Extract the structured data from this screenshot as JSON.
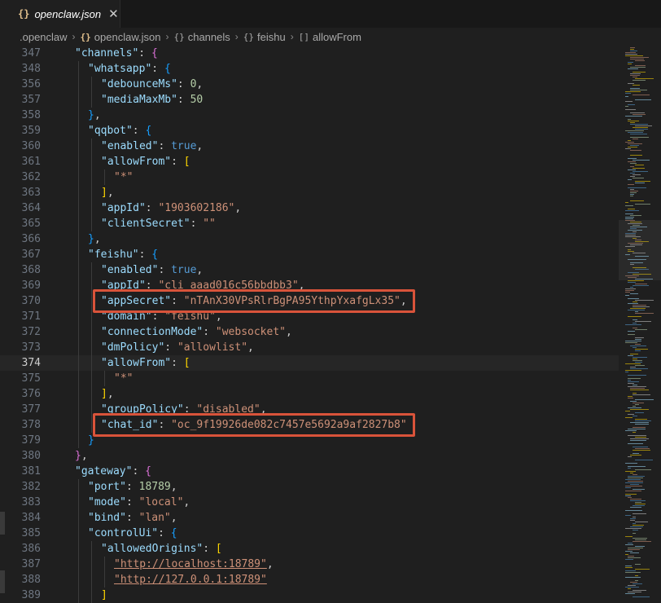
{
  "tab": {
    "icon": "{}",
    "name": "openclaw.json",
    "close": "✕"
  },
  "breadcrumb": [
    {
      "icon": "",
      "label": ".openclaw"
    },
    {
      "icon": "{}",
      "label": "openclaw.json"
    },
    {
      "icon": "{}",
      "label": "channels"
    },
    {
      "icon": "{}",
      "label": "feishu"
    },
    {
      "icon": "[]",
      "label": "allowFrom"
    }
  ],
  "editor": {
    "current_line": 374,
    "lines": [
      {
        "num": "347",
        "indent": 0,
        "tokens": [
          [
            "k",
            "\"channels\""
          ],
          [
            "p",
            ": "
          ],
          [
            "br2",
            "{"
          ]
        ]
      },
      {
        "num": "348",
        "indent": 1,
        "tokens": [
          [
            "k",
            "\"whatsapp\""
          ],
          [
            "p",
            ": "
          ],
          [
            "br3",
            "{"
          ]
        ]
      },
      {
        "num": "356",
        "indent": 2,
        "tokens": [
          [
            "k",
            "\"debounceMs\""
          ],
          [
            "p",
            ": "
          ],
          [
            "n",
            "0"
          ],
          [
            "p",
            ","
          ]
        ]
      },
      {
        "num": "357",
        "indent": 2,
        "tokens": [
          [
            "k",
            "\"mediaMaxMb\""
          ],
          [
            "p",
            ": "
          ],
          [
            "n",
            "50"
          ]
        ]
      },
      {
        "num": "358",
        "indent": 1,
        "tokens": [
          [
            "br3",
            "}"
          ],
          [
            "p",
            ","
          ]
        ]
      },
      {
        "num": "359",
        "indent": 1,
        "tokens": [
          [
            "k",
            "\"qqbot\""
          ],
          [
            "p",
            ": "
          ],
          [
            "br3",
            "{"
          ]
        ]
      },
      {
        "num": "360",
        "indent": 2,
        "tokens": [
          [
            "k",
            "\"enabled\""
          ],
          [
            "p",
            ": "
          ],
          [
            "b",
            "true"
          ],
          [
            "p",
            ","
          ]
        ]
      },
      {
        "num": "361",
        "indent": 2,
        "tokens": [
          [
            "k",
            "\"allowFrom\""
          ],
          [
            "p",
            ": "
          ],
          [
            "br1",
            "["
          ]
        ]
      },
      {
        "num": "362",
        "indent": 3,
        "tokens": [
          [
            "s",
            "\"*\""
          ]
        ]
      },
      {
        "num": "363",
        "indent": 2,
        "tokens": [
          [
            "br1",
            "]"
          ],
          [
            "p",
            ","
          ]
        ]
      },
      {
        "num": "364",
        "indent": 2,
        "tokens": [
          [
            "k",
            "\"appId\""
          ],
          [
            "p",
            ": "
          ],
          [
            "s",
            "\"1903602186\""
          ],
          [
            "p",
            ","
          ]
        ]
      },
      {
        "num": "365",
        "indent": 2,
        "tokens": [
          [
            "k",
            "\"clientSecret\""
          ],
          [
            "p",
            ": "
          ],
          [
            "s",
            "\"\""
          ]
        ]
      },
      {
        "num": "366",
        "indent": 1,
        "tokens": [
          [
            "br3",
            "}"
          ],
          [
            "p",
            ","
          ]
        ]
      },
      {
        "num": "367",
        "indent": 1,
        "tokens": [
          [
            "k",
            "\"feishu\""
          ],
          [
            "p",
            ": "
          ],
          [
            "br3",
            "{"
          ]
        ]
      },
      {
        "num": "368",
        "indent": 2,
        "tokens": [
          [
            "k",
            "\"enabled\""
          ],
          [
            "p",
            ": "
          ],
          [
            "b",
            "true"
          ],
          [
            "p",
            ","
          ]
        ]
      },
      {
        "num": "369",
        "indent": 2,
        "tokens": [
          [
            "k",
            "\"appId\""
          ],
          [
            "p",
            ": "
          ],
          [
            "s",
            "\"cli_aaad016c56bbdbb3\""
          ],
          [
            "p",
            ","
          ]
        ]
      },
      {
        "num": "370",
        "indent": 2,
        "tokens": [
          [
            "k",
            "\"appSecret\""
          ],
          [
            "p",
            ": "
          ],
          [
            "s",
            "\"nTAnX30VPsRlrBgPA95YthpYxafgLx35\""
          ],
          [
            "p",
            ","
          ]
        ]
      },
      {
        "num": "371",
        "indent": 2,
        "tokens": [
          [
            "k",
            "\"domain\""
          ],
          [
            "p",
            ": "
          ],
          [
            "s",
            "\"feishu\""
          ],
          [
            "p",
            ","
          ]
        ]
      },
      {
        "num": "372",
        "indent": 2,
        "tokens": [
          [
            "k",
            "\"connectionMode\""
          ],
          [
            "p",
            ": "
          ],
          [
            "s",
            "\"websocket\""
          ],
          [
            "p",
            ","
          ]
        ]
      },
      {
        "num": "373",
        "indent": 2,
        "tokens": [
          [
            "k",
            "\"dmPolicy\""
          ],
          [
            "p",
            ": "
          ],
          [
            "s",
            "\"allowlist\""
          ],
          [
            "p",
            ","
          ]
        ]
      },
      {
        "num": "374",
        "indent": 2,
        "tokens": [
          [
            "k",
            "\"allowFrom\""
          ],
          [
            "p",
            ": "
          ],
          [
            "br1",
            "["
          ]
        ]
      },
      {
        "num": "375",
        "indent": 3,
        "tokens": [
          [
            "s",
            "\"*\""
          ]
        ]
      },
      {
        "num": "376",
        "indent": 2,
        "tokens": [
          [
            "br1",
            "]"
          ],
          [
            "p",
            ","
          ]
        ]
      },
      {
        "num": "377",
        "indent": 2,
        "tokens": [
          [
            "k",
            "\"groupPolicy\""
          ],
          [
            "p",
            ": "
          ],
          [
            "s",
            "\"disabled\""
          ],
          [
            "p",
            ","
          ]
        ]
      },
      {
        "num": "378",
        "indent": 2,
        "tokens": [
          [
            "k",
            "\"chat_id\""
          ],
          [
            "p",
            ": "
          ],
          [
            "s",
            "\"oc_9f19926de082c7457e5692a9af2827b8\""
          ]
        ]
      },
      {
        "num": "379",
        "indent": 1,
        "tokens": [
          [
            "br3",
            "}"
          ]
        ]
      },
      {
        "num": "380",
        "indent": 0,
        "tokens": [
          [
            "br2",
            "}"
          ],
          [
            "p",
            ","
          ]
        ]
      },
      {
        "num": "381",
        "indent": 0,
        "tokens": [
          [
            "k",
            "\"gateway\""
          ],
          [
            "p",
            ": "
          ],
          [
            "br2",
            "{"
          ]
        ]
      },
      {
        "num": "382",
        "indent": 1,
        "tokens": [
          [
            "k",
            "\"port\""
          ],
          [
            "p",
            ": "
          ],
          [
            "n",
            "18789"
          ],
          [
            "p",
            ","
          ]
        ]
      },
      {
        "num": "383",
        "indent": 1,
        "tokens": [
          [
            "k",
            "\"mode\""
          ],
          [
            "p",
            ": "
          ],
          [
            "s",
            "\"local\""
          ],
          [
            "p",
            ","
          ]
        ]
      },
      {
        "num": "384",
        "indent": 1,
        "tokens": [
          [
            "k",
            "\"bind\""
          ],
          [
            "p",
            ": "
          ],
          [
            "s",
            "\"lan\""
          ],
          [
            "p",
            ","
          ]
        ]
      },
      {
        "num": "385",
        "indent": 1,
        "tokens": [
          [
            "k",
            "\"controlUi\""
          ],
          [
            "p",
            ": "
          ],
          [
            "br3",
            "{"
          ]
        ]
      },
      {
        "num": "386",
        "indent": 2,
        "tokens": [
          [
            "k",
            "\"allowedOrigins\""
          ],
          [
            "p",
            ": "
          ],
          [
            "br1",
            "["
          ]
        ]
      },
      {
        "num": "387",
        "indent": 3,
        "tokens": [
          [
            "s url",
            "\"http://localhost:18789\""
          ],
          [
            "p",
            ","
          ]
        ]
      },
      {
        "num": "388",
        "indent": 3,
        "tokens": [
          [
            "s url",
            "\"http://127.0.0.1:18789\""
          ]
        ]
      },
      {
        "num": "389",
        "indent": 2,
        "tokens": [
          [
            "br1",
            "]"
          ]
        ]
      },
      {
        "num": "390",
        "indent": 1,
        "tokens": [
          [
            "br3",
            "}"
          ],
          [
            "p",
            ","
          ]
        ]
      }
    ]
  },
  "highlights": [
    {
      "line": "370",
      "label": "appSecret"
    },
    {
      "line": "378",
      "label": "chat_id"
    }
  ],
  "colors": {
    "highlight_border": "#d9533a",
    "editor_bg": "#1f1f1f",
    "key": "#9cdcfe",
    "string": "#ce9178",
    "number": "#b5cea8",
    "boolean": "#569cd6"
  }
}
